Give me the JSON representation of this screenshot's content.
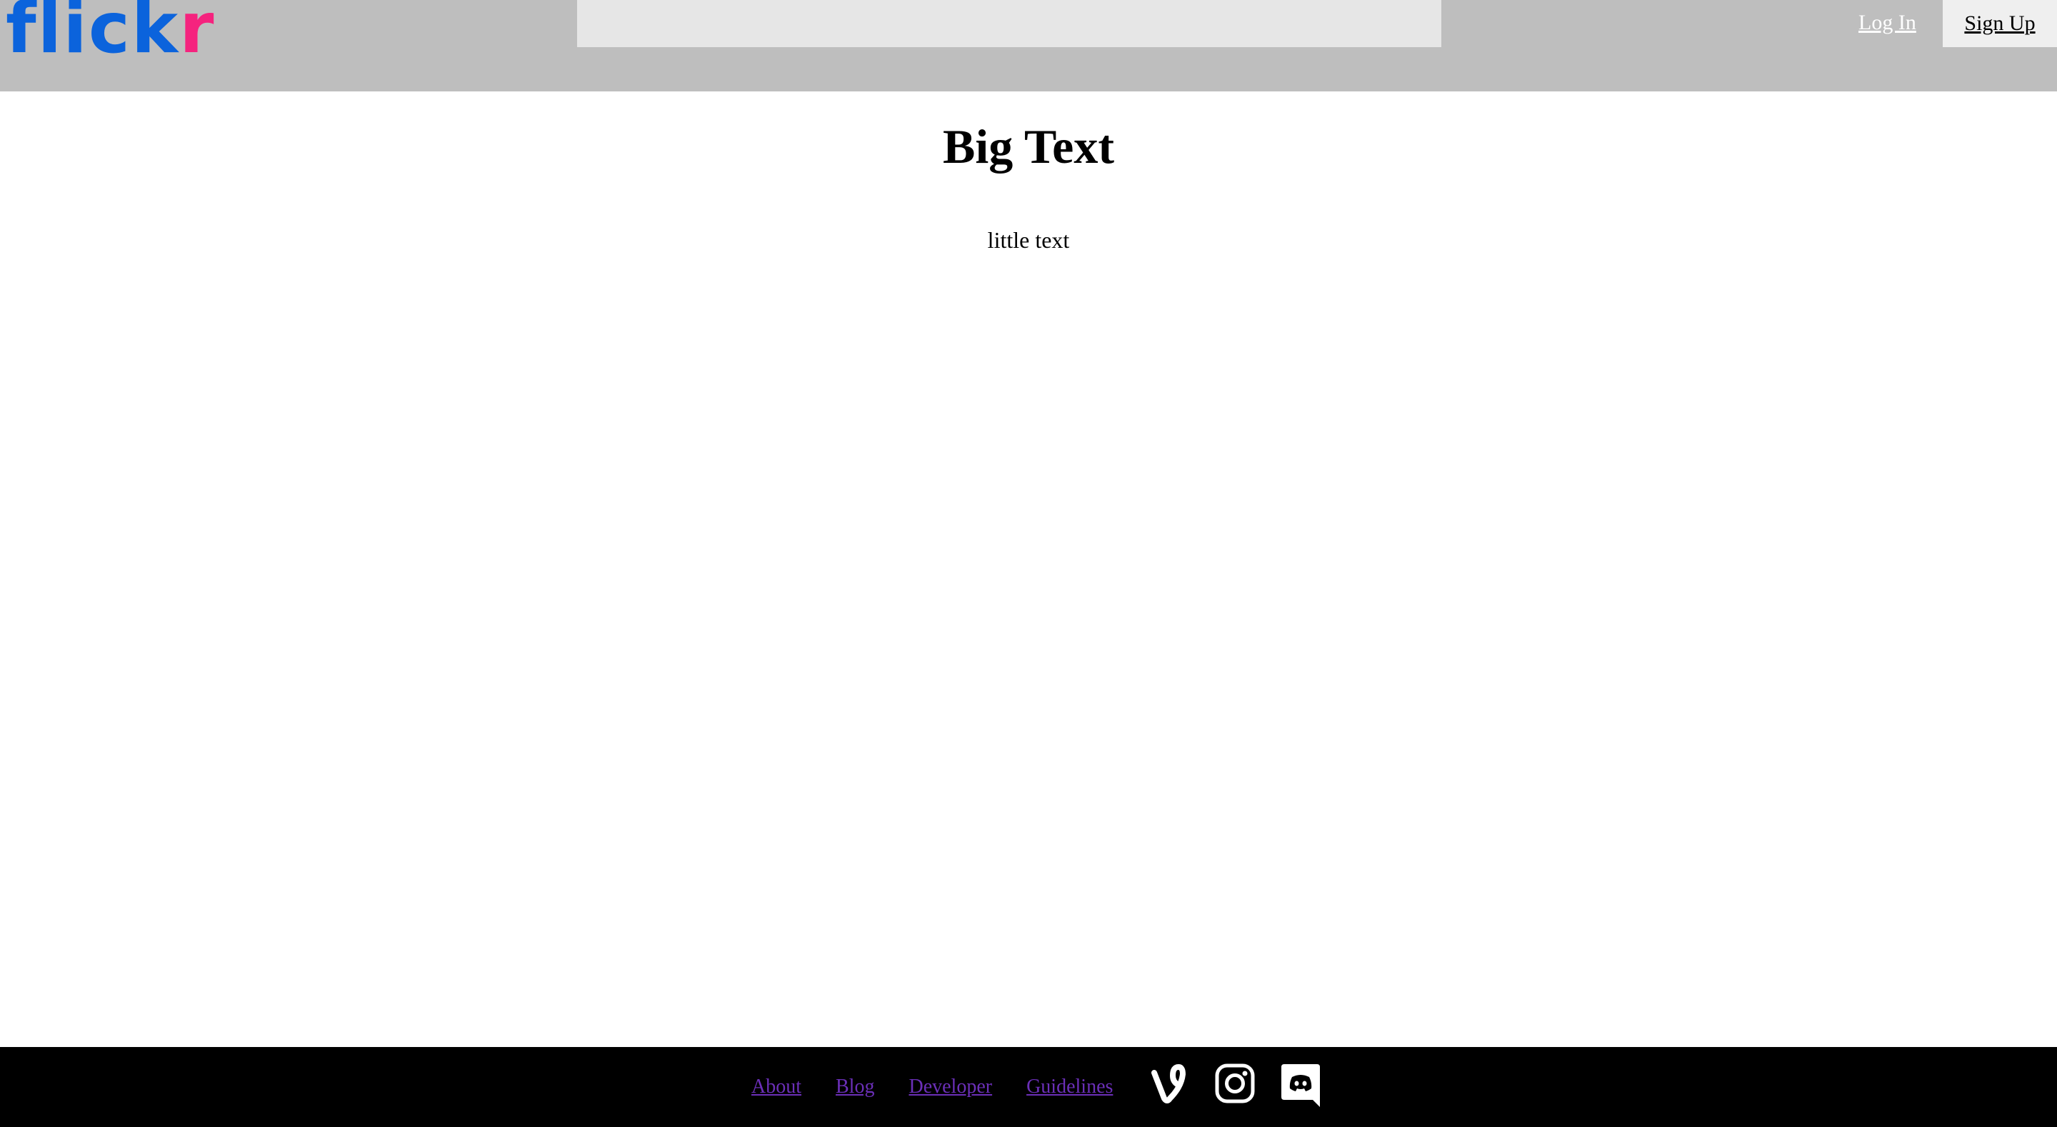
{
  "header": {
    "logo": {
      "part1": "flick",
      "part2": "r",
      "color_blue": "#0b63dc",
      "color_pink": "#f5237e"
    },
    "search": {
      "value": "",
      "placeholder": ""
    },
    "login_label": "Log In",
    "signup_label": "Sign Up",
    "background_color": "#bebebe"
  },
  "main": {
    "heading": "Big Text",
    "subtext": "little text"
  },
  "footer": {
    "links": [
      {
        "label": "About"
      },
      {
        "label": "Blog"
      },
      {
        "label": "Developer"
      },
      {
        "label": "Guidelines"
      }
    ],
    "link_color": "#6b2fb8",
    "social_icons": [
      "vine-icon",
      "instagram-icon",
      "discord-icon"
    ],
    "background_color": "#000000"
  }
}
